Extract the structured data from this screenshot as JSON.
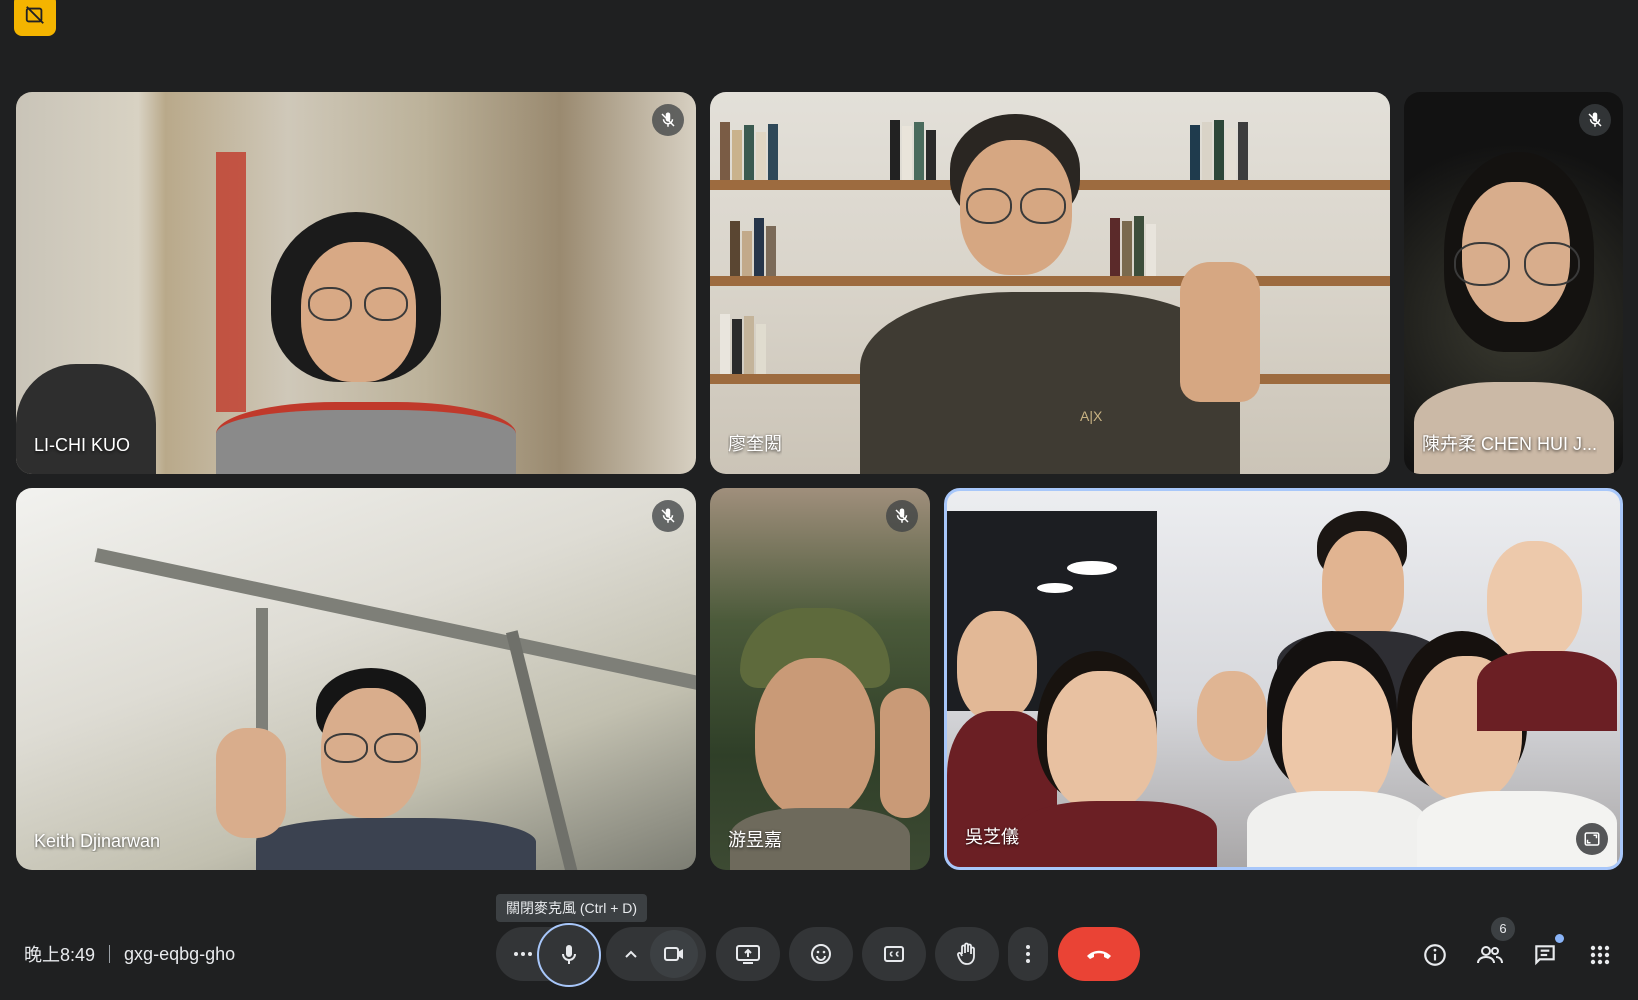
{
  "meeting": {
    "time": "晚上8:49",
    "code": "gxg-eqbg-gho"
  },
  "tooltip": {
    "mic": "關閉麥克風 (Ctrl + D)"
  },
  "participants": [
    {
      "name": "LI-CHI KUO",
      "muted": true
    },
    {
      "name": "廖奎閎",
      "muted": false
    },
    {
      "name": "陳卉柔 CHEN HUI J...",
      "muted": true
    },
    {
      "name": "Keith Djinarwan",
      "muted": true
    },
    {
      "name": "游昱嘉",
      "muted": true
    },
    {
      "name": "吳芝儀",
      "muted": false,
      "active_speaker": true
    }
  ],
  "people_count": "6",
  "colors": {
    "background": "#1f2021",
    "control_bg": "#333537",
    "end_call": "#ea4335",
    "active_border": "#a8c7fa",
    "record_badge": "#f4b400"
  }
}
